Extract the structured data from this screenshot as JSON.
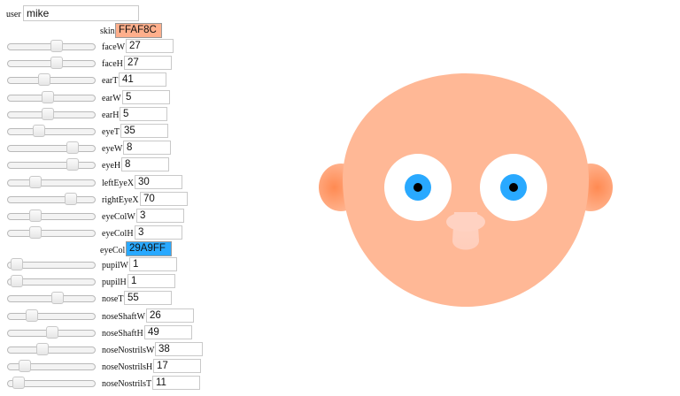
{
  "user": {
    "label": "user",
    "value": "mike"
  },
  "skin": {
    "label": "skin",
    "value": "FFAF8C",
    "color": "#FFAF8C"
  },
  "eyeCol": {
    "label": "eyeCol",
    "value": "29A9FF",
    "color": "#29A9FF"
  },
  "sliders": [
    {
      "label": "faceW",
      "value": "27",
      "level": 0.56
    },
    {
      "label": "faceH",
      "value": "27",
      "level": 0.56
    },
    {
      "label": "earT",
      "value": "41",
      "level": 0.42
    },
    {
      "label": "earW",
      "value": "5",
      "level": 0.46
    },
    {
      "label": "earH",
      "value": "5",
      "level": 0.46
    },
    {
      "label": "eyeT",
      "value": "35",
      "level": 0.36
    },
    {
      "label": "eyeW",
      "value": "8",
      "level": 0.74
    },
    {
      "label": "eyeH",
      "value": "8",
      "level": 0.74
    },
    {
      "label": "leftEyeX",
      "value": "30",
      "level": 0.32
    },
    {
      "label": "rightEyeX",
      "value": "70",
      "level": 0.72
    },
    {
      "label": "eyeColW",
      "value": "3",
      "level": 0.32
    },
    {
      "label": "eyeColH",
      "value": "3",
      "level": 0.32
    }
  ],
  "sliders2": [
    {
      "label": "pupilW",
      "value": "1",
      "level": 0.1
    },
    {
      "label": "pupilH",
      "value": "1",
      "level": 0.1
    },
    {
      "label": "noseT",
      "value": "55",
      "level": 0.57
    },
    {
      "label": "noseShaftW",
      "value": "26",
      "level": 0.28
    },
    {
      "label": "noseShaftH",
      "value": "49",
      "level": 0.51
    },
    {
      "label": "noseNostrilsW",
      "value": "38",
      "level": 0.4
    },
    {
      "label": "noseNostrilsH",
      "value": "17",
      "level": 0.19
    },
    {
      "label": "noseNostrilsT",
      "value": "11",
      "level": 0.12
    }
  ],
  "colors": {
    "skin": "#FFB896",
    "ear_glow": "#FF8A52",
    "eye_white": "#FFFFFF",
    "iris": "#29A9FF",
    "pupil": "#000000",
    "nose": "#FFD2C2"
  }
}
